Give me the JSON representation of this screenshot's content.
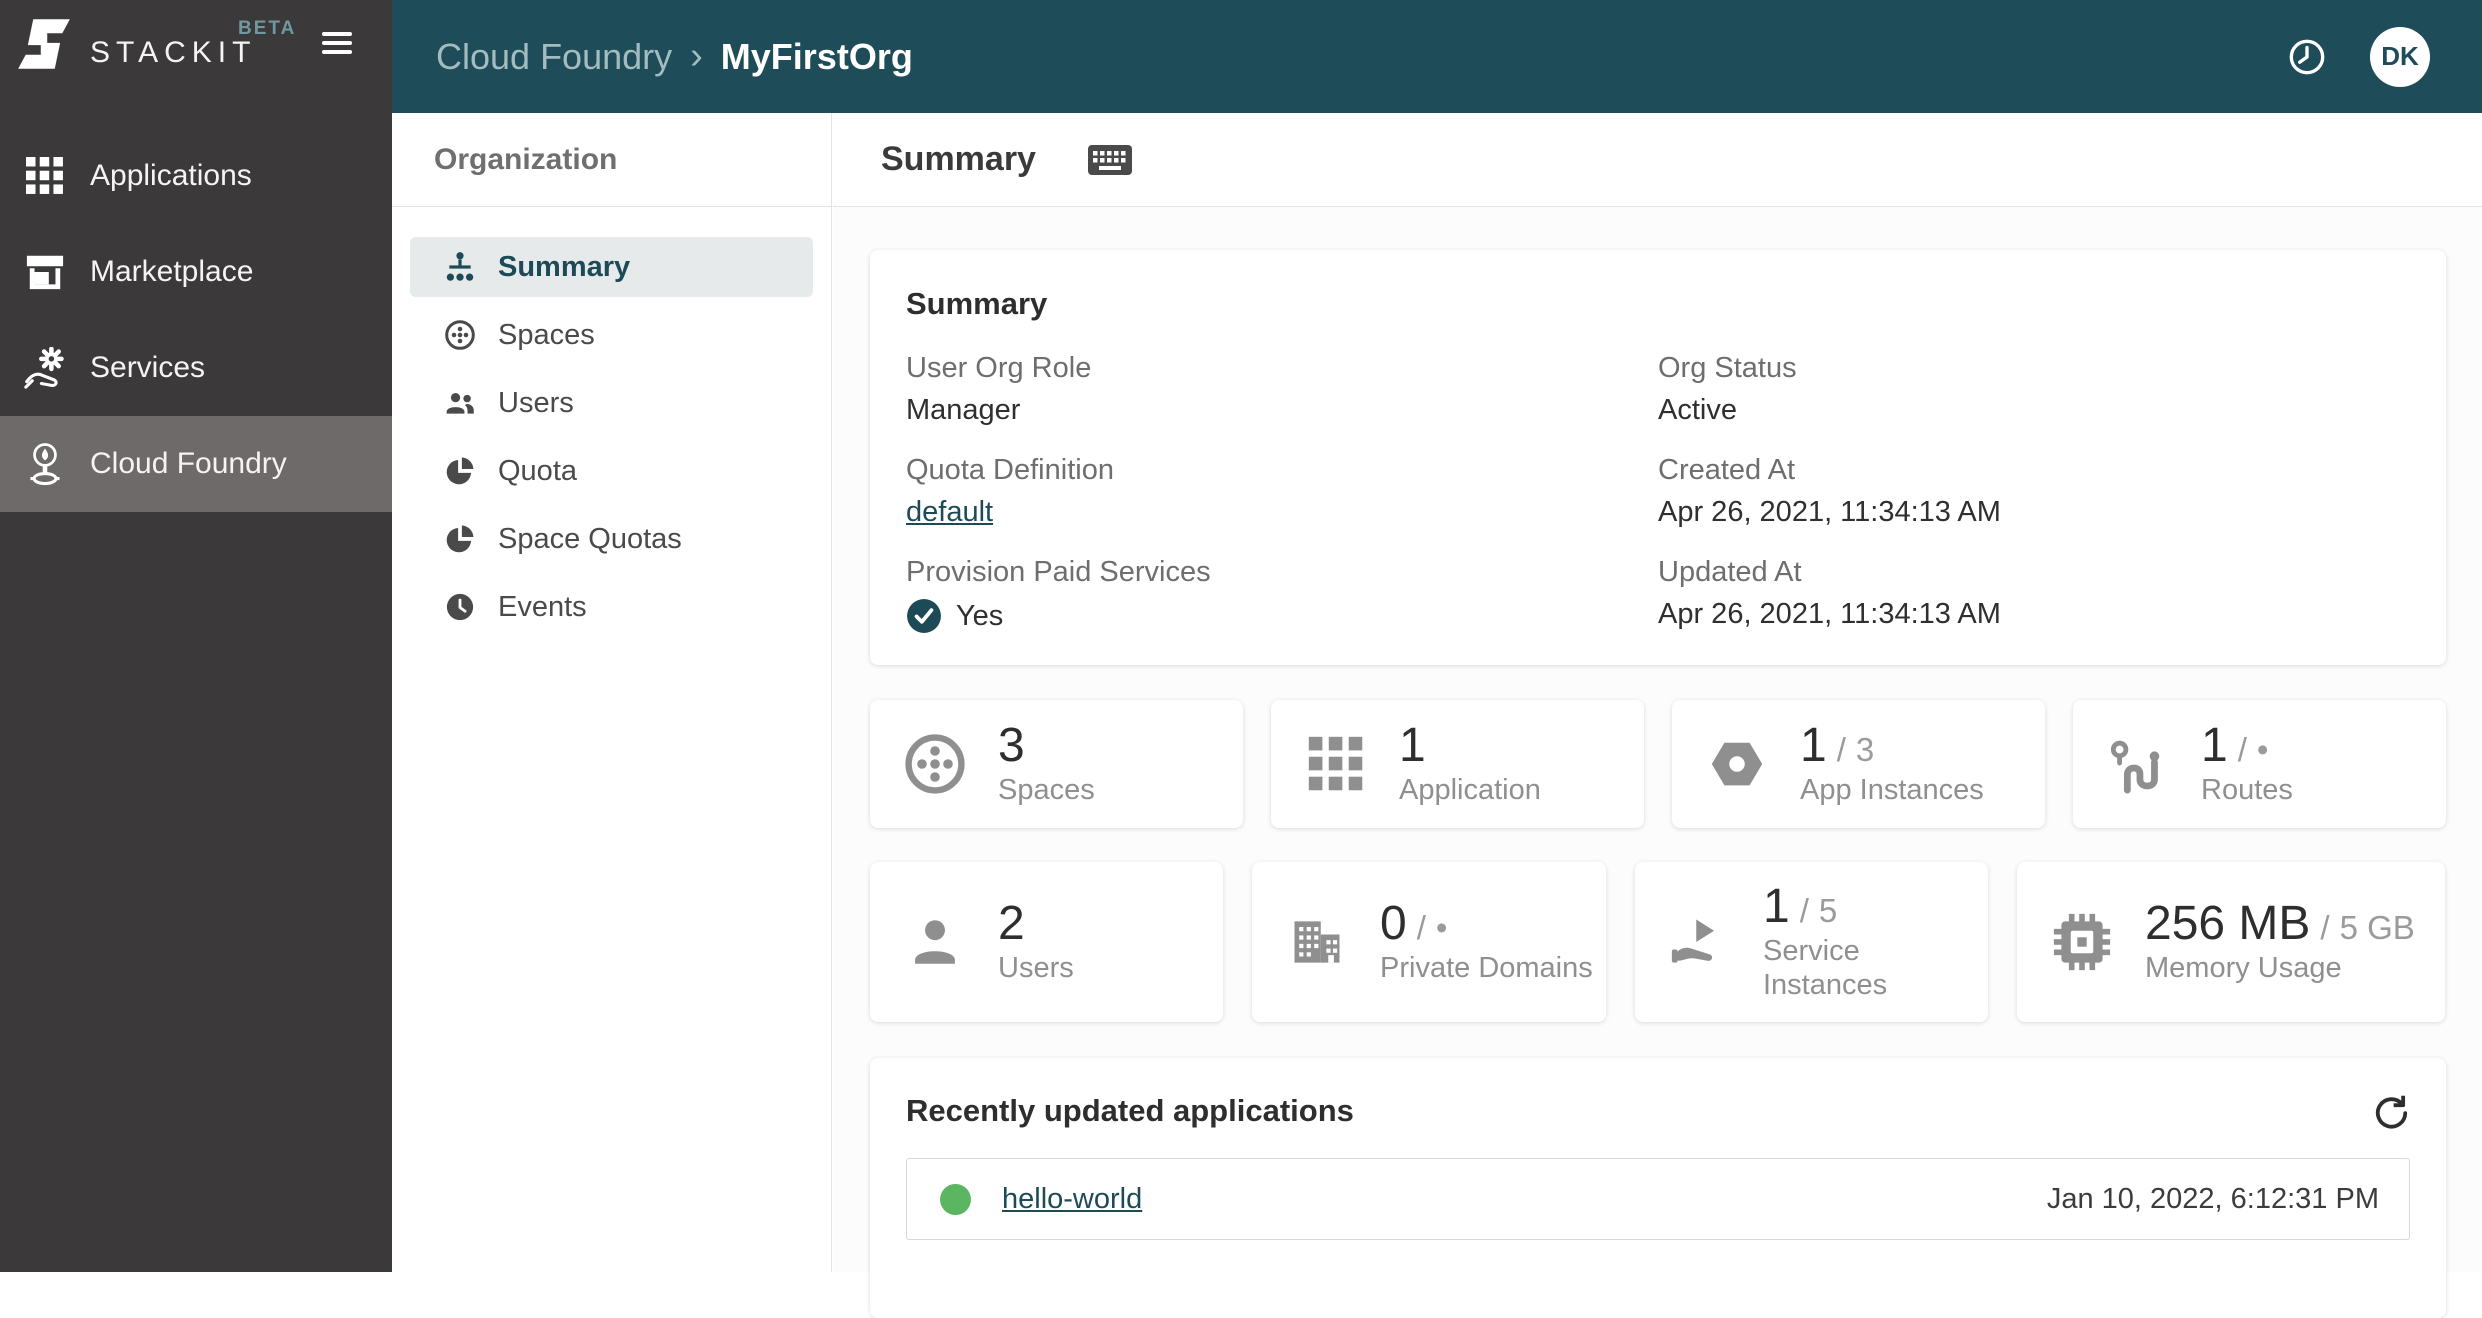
{
  "brand": {
    "wordmark": "STACKIT",
    "beta": "BETA"
  },
  "topbar": {
    "breadcrumb": {
      "parent": "Cloud Foundry",
      "separator": "›",
      "current": "MyFirstOrg"
    },
    "avatar_initials": "DK"
  },
  "sidebar": {
    "items": [
      {
        "label": "Applications",
        "icon": "grid",
        "selected": false
      },
      {
        "label": "Marketplace",
        "icon": "storefront",
        "selected": false
      },
      {
        "label": "Services",
        "icon": "hand-gear",
        "selected": false
      },
      {
        "label": "Cloud Foundry",
        "icon": "balloon-pin",
        "selected": true
      }
    ]
  },
  "orgnav": {
    "title": "Organization",
    "items": [
      {
        "label": "Summary",
        "icon": "sitemap",
        "selected": true
      },
      {
        "label": "Spaces",
        "icon": "circle-dots",
        "selected": false
      },
      {
        "label": "Users",
        "icon": "people",
        "selected": false
      },
      {
        "label": "Quota",
        "icon": "pie-chart",
        "selected": false
      },
      {
        "label": "Space Quotas",
        "icon": "pie-chart",
        "selected": false
      },
      {
        "label": "Events",
        "icon": "clock",
        "selected": false
      }
    ]
  },
  "main": {
    "page_title": "Summary",
    "summary_card": {
      "title": "Summary",
      "fields": [
        {
          "label": "User Org Role",
          "value": "Manager",
          "type": "text"
        },
        {
          "label": "Org Status",
          "value": "Active",
          "type": "text"
        },
        {
          "label": "Quota Definition",
          "value": "default",
          "type": "link"
        },
        {
          "label": "Created At",
          "value": "Apr 26, 2021, 11:34:13 AM",
          "type": "text"
        },
        {
          "label": "Provision Paid Services",
          "value": "Yes",
          "type": "check"
        },
        {
          "label": "Updated At",
          "value": "Apr 26, 2021, 11:34:13 AM",
          "type": "text"
        }
      ]
    },
    "stats": [
      {
        "icon": "circle-dots",
        "value": "3",
        "label": "Spaces"
      },
      {
        "icon": "grid",
        "value": "1",
        "label": "Application"
      },
      {
        "icon": "hexagon",
        "value": "1",
        "limit": "3",
        "label": "App Instances"
      },
      {
        "icon": "route",
        "value": "1",
        "limit": "•",
        "label": "Routes"
      },
      {
        "icon": "person",
        "value": "2",
        "label": "Users"
      },
      {
        "icon": "building",
        "value": "0",
        "limit": "•",
        "label": "Private Domains"
      },
      {
        "icon": "hand-play",
        "value": "1",
        "limit": "5",
        "label": "Service Instances"
      },
      {
        "icon": "memory-chip",
        "value": "256 MB",
        "limit": "5 GB",
        "label": "Memory Usage"
      }
    ],
    "recent": {
      "title": "Recently updated applications",
      "rows": [
        {
          "name": "hello-world",
          "status": "running",
          "updated_at": "Jan 10, 2022, 6:12:31 PM"
        }
      ]
    }
  },
  "ui": {
    "slash": "/"
  },
  "colors": {
    "topbar": "#1e4c59",
    "sidebar": "#3b3939",
    "sidebar_selected": "#6d6a69",
    "accent_teal": "#1d4a57",
    "nav_selected_bg": "#e7eaea",
    "status_green": "#5cb561",
    "icon_gray": "#8f8f8f"
  }
}
